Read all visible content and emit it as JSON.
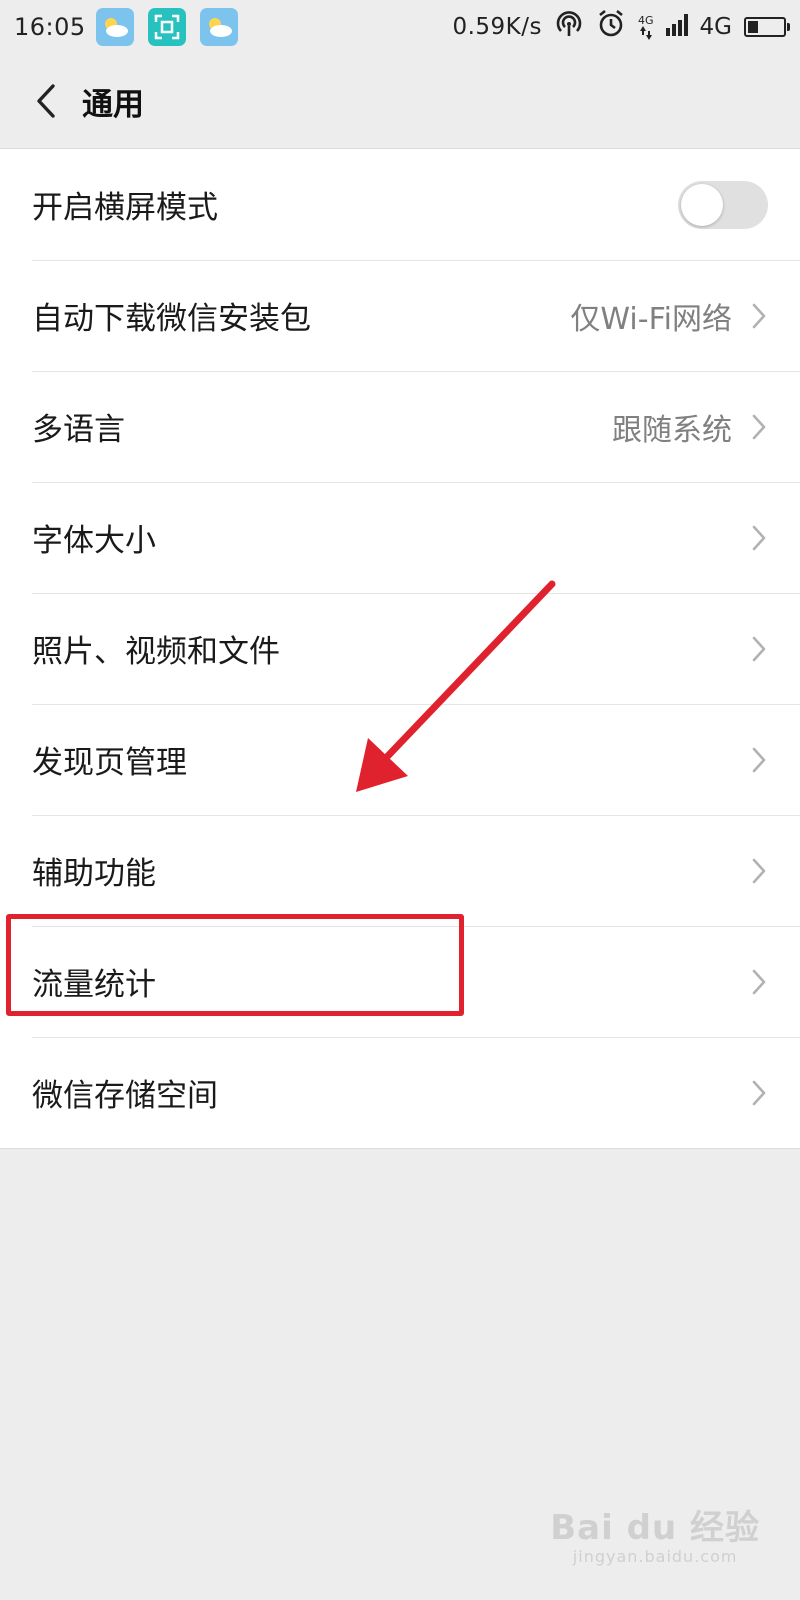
{
  "status_bar": {
    "time": "16:05",
    "net_speed": "0.59K/s",
    "network_small": "4G",
    "network": "4G",
    "battery_level": 0.3,
    "app_icons": [
      "weather-icon",
      "scan-icon",
      "weather-icon"
    ]
  },
  "nav": {
    "title": "通用"
  },
  "settings": {
    "landscape": {
      "label": "开启横屏模式",
      "enabled": false
    },
    "auto_download": {
      "label": "自动下载微信安装包",
      "value": "仅Wi-Fi网络"
    },
    "language": {
      "label": "多语言",
      "value": "跟随系统"
    },
    "font_size": {
      "label": "字体大小"
    },
    "media": {
      "label": "照片、视频和文件"
    },
    "discover": {
      "label": "发现页管理"
    },
    "accessibility": {
      "label": "辅助功能"
    },
    "traffic": {
      "label": "流量统计"
    },
    "storage": {
      "label": "微信存储空间"
    }
  },
  "annotation": {
    "color": "#e0222e"
  },
  "watermark": {
    "main": "Bai du 经验",
    "sub": "jingyan.baidu.com"
  }
}
